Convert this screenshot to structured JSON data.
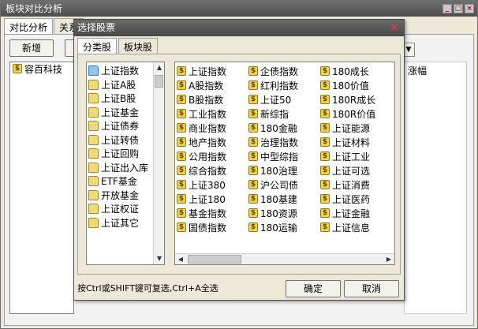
{
  "main": {
    "title": "板块对比分析",
    "tabs": [
      "对比分析",
      "关系"
    ],
    "add_button": "新增",
    "list": [
      "容百科技"
    ],
    "right_header": "涨幅"
  },
  "dialog": {
    "title": "选择股票",
    "tabs": [
      "分类股",
      "板块股"
    ],
    "tree": [
      "上证指数",
      "上证A股",
      "上证B股",
      "上证基金",
      "上证债券",
      "上证转债",
      "上证回购",
      "上证出入库",
      "ETF基金",
      "开放基金",
      "上证权证",
      "上证其它"
    ],
    "columns": [
      [
        "上证指数",
        "A股指数",
        "B股指数",
        "工业指数",
        "商业指数",
        "地产指数",
        "公用指数",
        "综合指数",
        "上证380",
        "上证180",
        "基金指数",
        "国债指数"
      ],
      [
        "企债指数",
        "红利指数",
        "上证50",
        "新综指",
        "180金融",
        "治理指数",
        "中型综指",
        "180治理",
        "沪公司债",
        "180基建",
        "180资源",
        "180运输"
      ],
      [
        "180成长",
        "180价值",
        "180R成长",
        "180R价值",
        "上证能源",
        "上证材料",
        "上证工业",
        "上证可选",
        "上证消费",
        "上证医药",
        "上证金融",
        "上证信息"
      ]
    ],
    "hint": "按Ctrl或SHIFT键可复选,Ctrl+A全选",
    "ok_label": "确定",
    "cancel_label": "取消"
  }
}
